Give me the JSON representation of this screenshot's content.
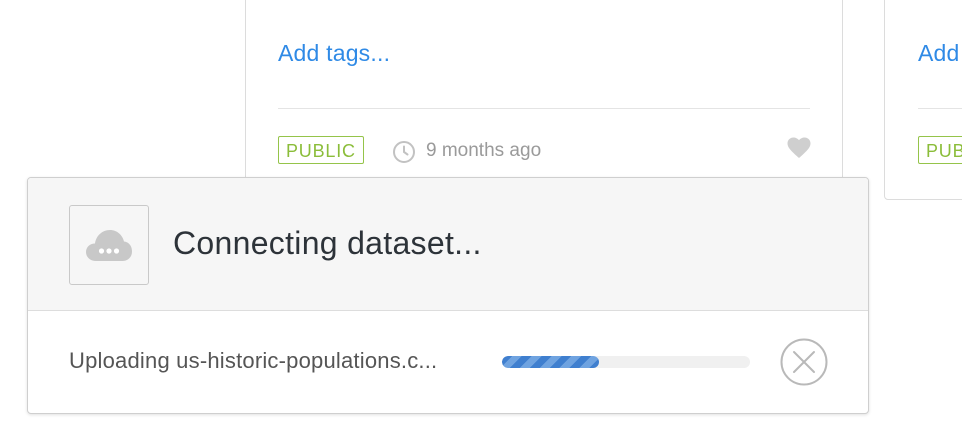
{
  "card_main": {
    "add_tags": "Add tags...",
    "visibility": "PUBLIC",
    "updated": "9 months ago",
    "icons": {
      "clock": "clock-icon",
      "favorite": "heart-icon"
    }
  },
  "card_right": {
    "add_tags": "Add",
    "visibility": "PUB"
  },
  "upload_modal": {
    "title": "Connecting dataset...",
    "status_text": "Uploading us-historic-populations.c...",
    "progress_fraction": 0.39,
    "icons": {
      "thumbnail": "cloud-icon",
      "cancel": "close-circle-icon"
    }
  },
  "colors": {
    "link": "#2f8ae6",
    "public_badge": "#8bbd3a",
    "progress": "#3f7fcf"
  }
}
